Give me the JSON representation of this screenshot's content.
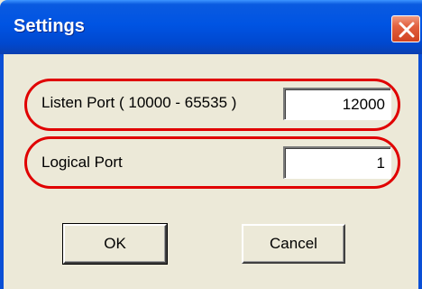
{
  "window": {
    "title": "Settings"
  },
  "fields": {
    "listen_port": {
      "label": "Listen Port ( 10000 - 65535 )",
      "value": "12000"
    },
    "logical_port": {
      "label": "Logical Port",
      "value": "1"
    }
  },
  "buttons": {
    "ok_label": "OK",
    "cancel_label": "Cancel"
  },
  "colors": {
    "titlebar": "#0054e3",
    "highlight": "#e00000",
    "close": "#d0421f",
    "face": "#ece9d8"
  }
}
